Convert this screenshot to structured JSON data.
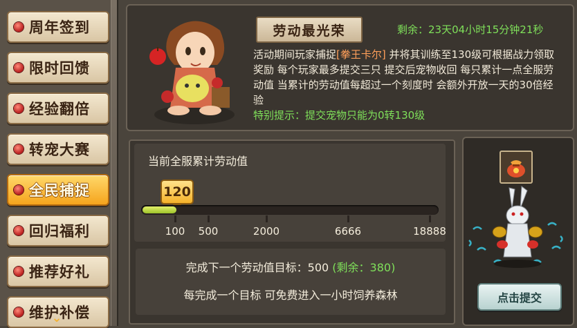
{
  "sidebar": {
    "items": [
      {
        "label": "周年签到",
        "active": false
      },
      {
        "label": "限时回馈",
        "active": false
      },
      {
        "label": "经验翻倍",
        "active": false
      },
      {
        "label": "转宠大赛",
        "active": false
      },
      {
        "label": "全民捕捉",
        "active": true
      },
      {
        "label": "回归福利",
        "active": false
      },
      {
        "label": "推荐好礼",
        "active": false
      },
      {
        "label": "维护补偿",
        "active": false
      }
    ],
    "more_icon": "chevron-down-icon"
  },
  "event": {
    "title": "劳动最光荣",
    "remaining_label": "剩余：",
    "remaining_value": "23天04小时15分钟21秒",
    "desc_prefix": "活动期间玩家捕捉",
    "desc_highlight": "[拳王卡尔]",
    "desc_rest": " 并将其训练至130级可根据战力领取奖励  每个玩家最多提交三只  提交后宠物收回  每只累计一点全服劳动值  当累计的劳动值每超过一个刻度时  会额外开放一天的30倍经验",
    "tip": "特别提示：提交宠物只能为0转130级"
  },
  "progress": {
    "title": "当前全服累计劳动值",
    "current": "120",
    "current_value": 120,
    "ticks": [
      "100",
      "500",
      "2000",
      "6666",
      "18888"
    ]
  },
  "goal": {
    "line1_prefix": "完成下一个劳动值目标：500",
    "line1_remaining": "(剩余：380)",
    "line2": "每完成一个目标  可免费进入一小时饲养森林"
  },
  "submit": {
    "button_label": "点击提交",
    "item_icon": "money-bag-icon",
    "pet_icon": "rabbit-pet-icon"
  },
  "colors": {
    "accent_green": "#7fe05a",
    "highlight_orange": "#ff9f5a",
    "active_tab": "#f5a41d"
  }
}
